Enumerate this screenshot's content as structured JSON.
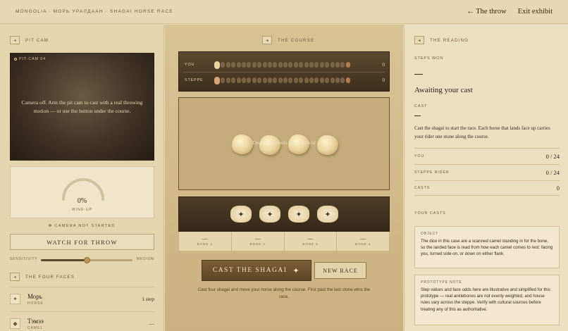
{
  "header": {
    "breadcrumb": "MONGOLIA · МОРЬ УРАЛДААН · SHAGAI HORSE RACE",
    "back_label": "← The throw",
    "exit_label": "Exit exhibit"
  },
  "left": {
    "pitcam_title": "PIT CAM",
    "feed_tag": "PIT-CAM 04",
    "camera_message": "Camera off. Arm the pit cam to cast with a real throwing motion — or use the button under the course.",
    "windup": {
      "value_text": "0%",
      "label": "WIND-UP",
      "fraction": 0
    },
    "camera_status": "CAMERA NOT STARTED",
    "watch_button": "WATCH FOR THROW",
    "sensitivity": {
      "label": "SENSITIVITY",
      "value_label": "MEDIUM",
      "fraction": 0.5
    },
    "faces_title": "THE FOUR FACES",
    "faces": [
      {
        "name": "Морь",
        "type": "HORSE",
        "value": "1 step",
        "icon": "four-point-star-icon"
      },
      {
        "name": "Тэмээ",
        "type": "CAMEL",
        "value": "—",
        "icon": "camel-icon"
      }
    ]
  },
  "middle": {
    "course_title": "THE COURSE",
    "lanes": [
      {
        "label": "YOU",
        "count": "0"
      },
      {
        "label": "STEPPE",
        "count": "0"
      }
    ],
    "course_steps": 24,
    "tray_hint": "Drop the camels into the field",
    "bones": [
      {
        "label": "BONE 1",
        "face": "—"
      },
      {
        "label": "BONE 2",
        "face": "—"
      },
      {
        "label": "BONE 3",
        "face": "—"
      },
      {
        "label": "BONE 4",
        "face": "—"
      }
    ],
    "cast_button": "CAST THE SHAGAI",
    "new_race_button": "NEW RACE",
    "note": "Cast four shagai and move your horse along the course. First past the last stone wins the race."
  },
  "right": {
    "reading_title": "THE READING",
    "steps_won_label": "STEPS WON",
    "steps_won_value": "—",
    "status": "Awaiting your cast",
    "cast_label": "CAST",
    "cast_value": "—",
    "description": "Cast the shagai to start the race. Each horse that lands face up carries your rider one stone along the course.",
    "stats": [
      {
        "label": "YOU",
        "value": "0 / 24"
      },
      {
        "label": "STEPPE RIDER",
        "value": "0 / 24"
      },
      {
        "label": "CASTS",
        "value": "0"
      }
    ],
    "casts_title": "YOUR CASTS",
    "object_card": {
      "title": "OBJECT",
      "body": "The dice in this case are a scanned camel standing in for the bone, so the landed face is read from how each camel comes to rest: facing you, turned side-on, or down on either flank."
    },
    "prototype_card": {
      "title": "PROTOTYPE NOTE",
      "body": "Step values and face odds here are illustrative and simplified for this prototype — real anklebones are not evenly weighted, and house rules vary across the steppe. Verify with cultural sources before treating any of this as authoritative."
    }
  },
  "colors": {
    "accent": "#6a5030",
    "background": "#e6d6b0",
    "dark_panel": "#3d2f1c"
  }
}
